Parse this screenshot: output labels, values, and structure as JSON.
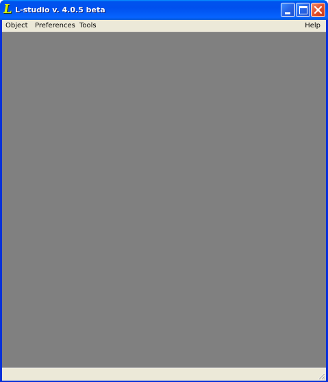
{
  "window": {
    "title": "L-studio v. 4.0.5 beta",
    "app_icon_glyph": "L",
    "title_bar_color": "#0053ee",
    "workspace_color": "#808080"
  },
  "menu": {
    "object": "Object",
    "preferences": "Preferences",
    "tools": "Tools",
    "help": "Help"
  },
  "icons": {
    "app": "l-studio-app-icon",
    "minimize": "minimize-icon",
    "maximize": "maximize-icon",
    "close": "close-icon",
    "resize": "resize-grip-icon"
  }
}
